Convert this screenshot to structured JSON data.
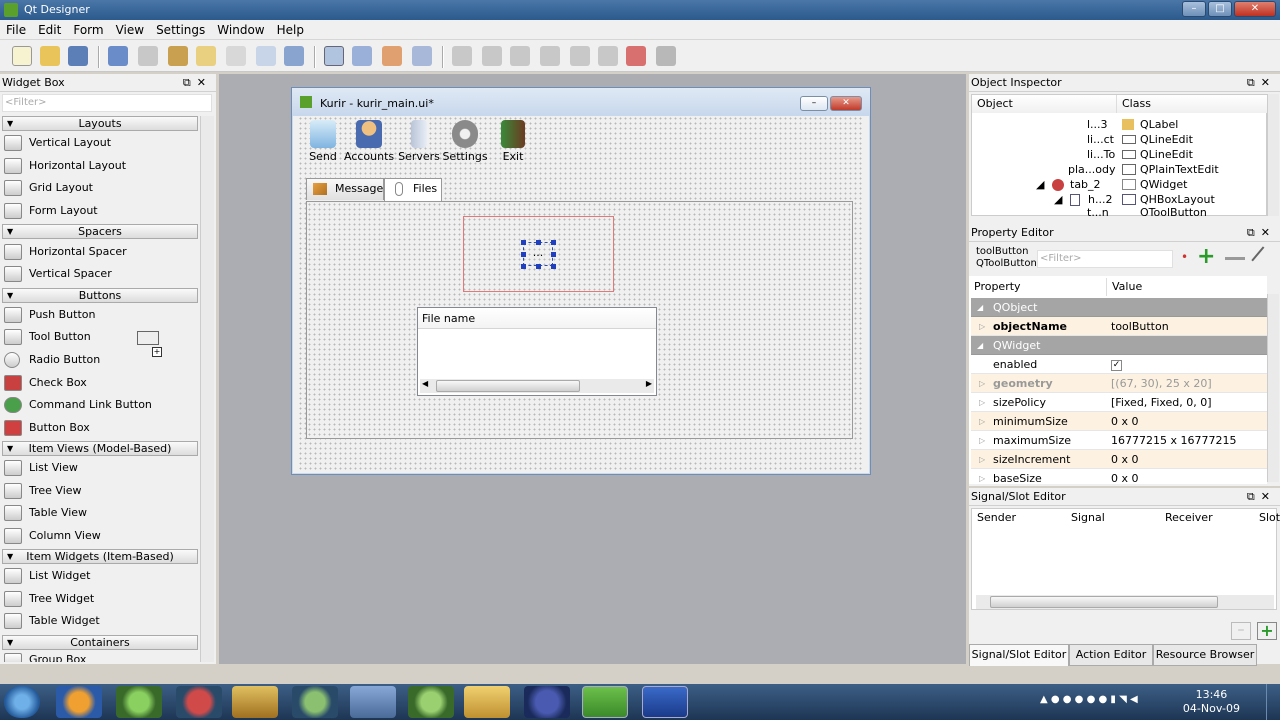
{
  "window": {
    "title": "Qt Designer"
  },
  "menubar": [
    "File",
    "Edit",
    "Form",
    "View",
    "Settings",
    "Window",
    "Help"
  ],
  "widget_box": {
    "title": "Widget Box",
    "filter_placeholder": "<Filter>",
    "categories": {
      "layouts": "Layouts",
      "spacers": "Spacers",
      "buttons": "Buttons",
      "item_views": "Item Views (Model-Based)",
      "item_widgets": "Item Widgets (Item-Based)",
      "containers": "Containers"
    },
    "items": {
      "vertical_layout": "Vertical Layout",
      "horizontal_layout": "Horizontal Layout",
      "grid_layout": "Grid Layout",
      "form_layout": "Form Layout",
      "horizontal_spacer": "Horizontal Spacer",
      "vertical_spacer": "Vertical Spacer",
      "push_button": "Push Button",
      "tool_button": "Tool Button",
      "radio_button": "Radio Button",
      "check_box": "Check Box",
      "command_link_button": "Command Link Button",
      "button_box": "Button Box",
      "list_view": "List View",
      "tree_view": "Tree View",
      "table_view": "Table View",
      "column_view": "Column View",
      "list_widget": "List Widget",
      "tree_widget": "Tree Widget",
      "table_widget": "Table Widget",
      "group_box": "Group Box"
    }
  },
  "form": {
    "title": "Kurir - kurir_main.ui*",
    "toolbar": [
      "Send",
      "Accounts",
      "Servers",
      "Settings",
      "Exit"
    ],
    "tabs": [
      "Message",
      "Files"
    ],
    "selected_button_text": "...",
    "file_column": "File name"
  },
  "object_inspector": {
    "title": "Object Inspector",
    "columns": [
      "Object",
      "Class"
    ],
    "rows": [
      {
        "object": "l...3",
        "class": "QLabel"
      },
      {
        "object": "li...ct",
        "class": "QLineEdit"
      },
      {
        "object": "li...To",
        "class": "QLineEdit"
      },
      {
        "object": "pla...ody",
        "class": "QPlainTextEdit"
      },
      {
        "object": "tab_2",
        "class": "QWidget"
      },
      {
        "object": "h...2",
        "class": "QHBoxLayout"
      },
      {
        "object": "t...n",
        "class": "QToolButton"
      }
    ]
  },
  "property_editor": {
    "title": "Property Editor",
    "object_name": "toolButton",
    "object_class": "QToolButton",
    "filter_placeholder": "<Filter>",
    "columns": [
      "Property",
      "Value"
    ],
    "rows": [
      {
        "group": "QObject"
      },
      {
        "name": "objectName",
        "value": "toolButton"
      },
      {
        "group": "QWidget"
      },
      {
        "name": "enabled",
        "value": ""
      },
      {
        "name": "geometry",
        "value": "[(67, 30), 25 x 20]"
      },
      {
        "name": "sizePolicy",
        "value": "[Fixed, Fixed, 0, 0]"
      },
      {
        "name": "minimumSize",
        "value": "0 x 0"
      },
      {
        "name": "maximumSize",
        "value": "16777215 x 16777215"
      },
      {
        "name": "sizeIncrement",
        "value": "0 x 0"
      },
      {
        "name": "baseSize",
        "value": "0 x 0"
      }
    ]
  },
  "signal_slot": {
    "title": "Signal/Slot Editor",
    "columns": [
      "Sender",
      "Signal",
      "Receiver",
      "Slot"
    ]
  },
  "dock_tabs": [
    "Signal/Slot Editor",
    "Action Editor",
    "Resource Browser"
  ],
  "clock": {
    "time": "13:46",
    "date": "04-Nov-09"
  },
  "colors": {
    "accent": "#4a76a8",
    "group_row": "#a5a5a5",
    "highlight_row": "#fdf2e1"
  }
}
